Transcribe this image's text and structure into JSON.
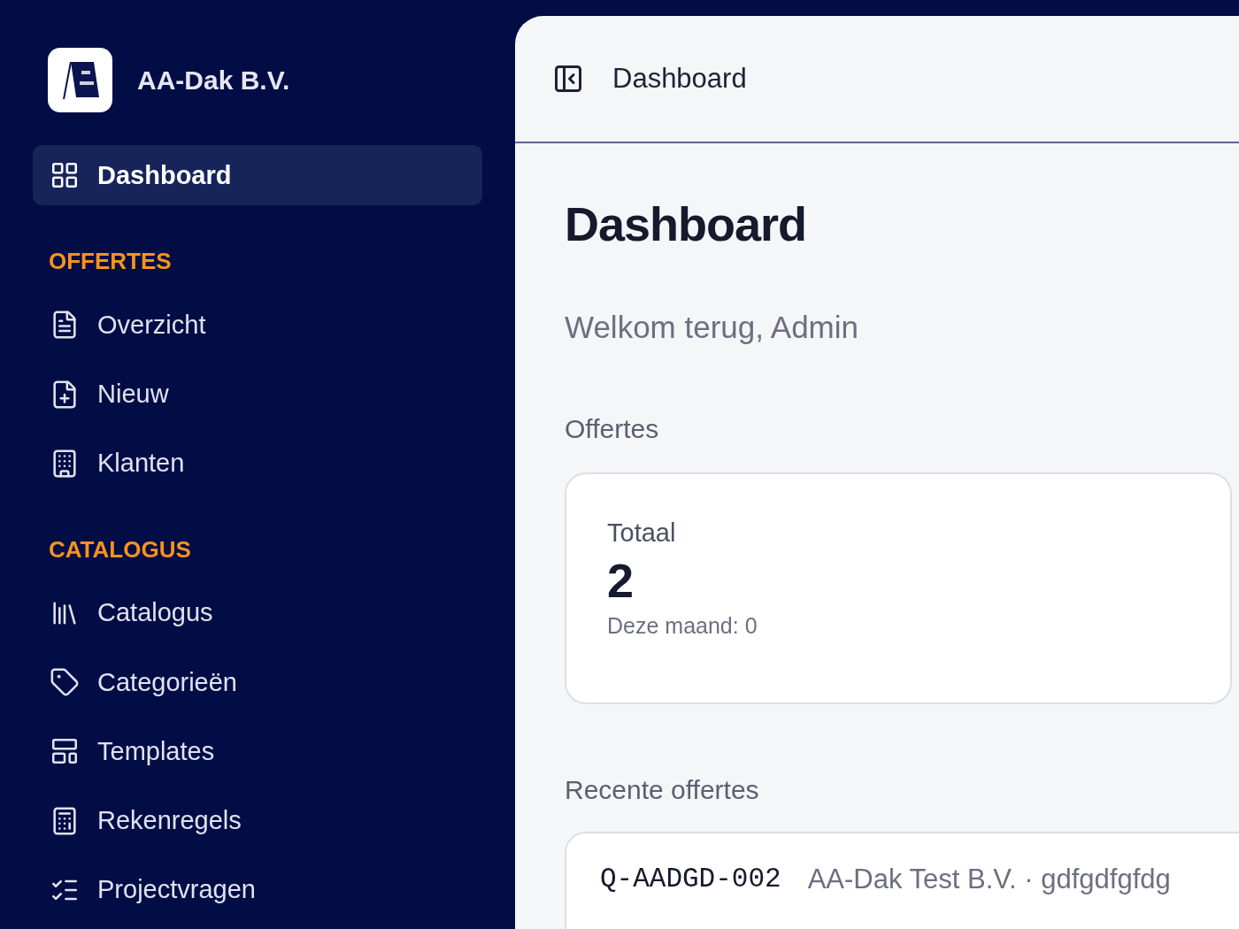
{
  "sidebar": {
    "brand": "AA-Dak B.V.",
    "items": [
      {
        "label": "Dashboard",
        "selected": true
      }
    ],
    "sections": [
      {
        "title": "OFFERTES",
        "items": [
          {
            "label": "Overzicht",
            "selected": false
          },
          {
            "label": "Nieuw",
            "selected": false
          },
          {
            "label": "Klanten",
            "selected": false
          }
        ]
      },
      {
        "title": "CATALOGUS",
        "items": [
          {
            "label": "Catalogus",
            "selected": false
          },
          {
            "label": "Categorieën",
            "selected": false
          },
          {
            "label": "Templates",
            "selected": false
          },
          {
            "label": "Rekenregels",
            "selected": false
          },
          {
            "label": "Projectvragen",
            "selected": false
          }
        ]
      }
    ]
  },
  "header": {
    "title": "Dashboard"
  },
  "page": {
    "title": "Dashboard",
    "welcome": "Welkom terug, Admin",
    "stats_heading": "Offertes",
    "stat": {
      "label": "Totaal",
      "value": "2",
      "note": "Deze maand: 0"
    },
    "recent_heading": "Recente offertes",
    "recent": [
      {
        "code": "Q-AADGD-002",
        "detail": "AA-Dak Test B.V. · gdfgdfgfdg"
      }
    ]
  }
}
